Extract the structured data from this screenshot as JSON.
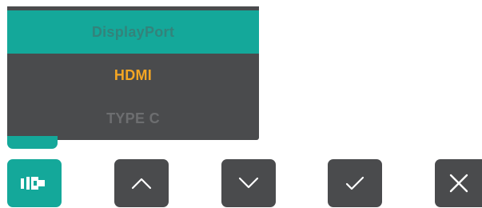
{
  "input_menu": {
    "items": [
      {
        "label": "DisplayPort",
        "state": "highlighted"
      },
      {
        "label": "HDMI",
        "state": "active"
      },
      {
        "label": "TYPE C",
        "state": "normal"
      }
    ]
  },
  "buttons": {
    "input_icon": "input-source-icon",
    "up_icon": "chevron-up-icon",
    "down_icon": "chevron-down-icon",
    "confirm_icon": "checkmark-icon",
    "close_icon": "close-icon"
  },
  "colors": {
    "highlight": "#14a89a",
    "active_text": "#f5a623",
    "panel": "#4a4b4d"
  }
}
